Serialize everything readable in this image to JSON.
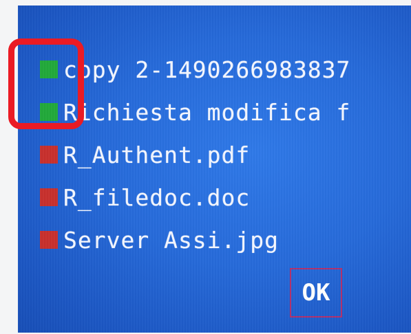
{
  "files": [
    {
      "name": "copy 2-1490266983837",
      "status": "success",
      "status_color": "#22a93a"
    },
    {
      "name": "Richiesta modifica f",
      "status": "success",
      "status_color": "#22a93a"
    },
    {
      "name": "R_Authent.pdf",
      "status": "error",
      "status_color": "#c8302d"
    },
    {
      "name": "R_filedoc.doc",
      "status": "error",
      "status_color": "#c8302d"
    },
    {
      "name": "Server Assi.jpg",
      "status": "error",
      "status_color": "#c8302d"
    }
  ],
  "ok_button": {
    "label": "OK"
  },
  "colors": {
    "screen_background": "#266ad9",
    "text": "#f4f7ff",
    "annotation": "#ea1b24",
    "ok_border": "#b2306b"
  },
  "annotation": {
    "shape": "rounded-rectangle",
    "highlights": "status indicators of first two files"
  }
}
